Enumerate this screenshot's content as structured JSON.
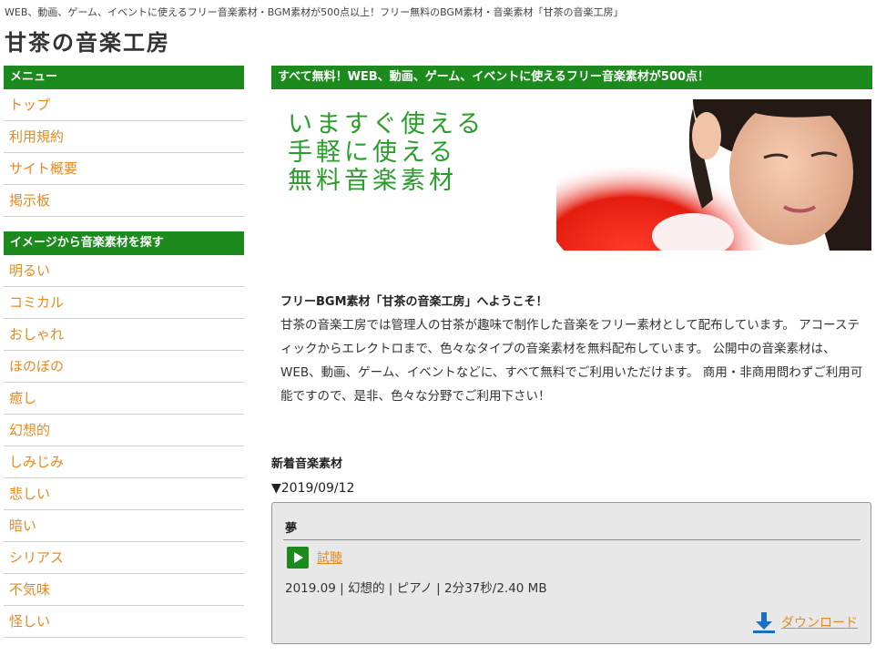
{
  "header": {
    "tagline": "WEB、動画、ゲーム、イベントに使えるフリー音楽素材・BGM素材が500点以上！フリー無料のBGM素材・音楽素材「甘茶の音楽工房」",
    "site_title": "甘茶の音楽工房"
  },
  "sidebar": {
    "menu_heading": "メニュー",
    "menu_items": [
      "トップ",
      "利用規約",
      "サイト概要",
      "掲示板"
    ],
    "image_heading": "イメージから音楽素材を探す",
    "image_items": [
      "明るい",
      "コミカル",
      "おしゃれ",
      "ほのぼの",
      "癒し",
      "幻想的",
      "しみじみ",
      "悲しい",
      "暗い",
      "シリアス",
      "不気味",
      "怪しい"
    ]
  },
  "main": {
    "banner_heading": "すべて無料！WEB、動画、ゲーム、イベントに使えるフリー音楽素材が500点！",
    "hero_lines": [
      "いますぐ使える",
      "手軽に使える",
      "無料音楽素材"
    ],
    "welcome_title": "フリーBGM素材「甘茶の音楽工房」へようこそ！",
    "welcome_body": "甘茶の音楽工房では管理人の甘茶が趣味で制作した音楽をフリー素材として配布しています。 アコースティックからエレクトロまで、色々なタイプの音楽素材を無料配布しています。 公開中の音楽素材は、WEB、動画、ゲーム、イベントなどに、すべて無料でご利用いただけます。 商用・非商用問わずご利用可能ですので、是非、色々な分野でご利用下さい！",
    "news_heading": "新着音楽素材",
    "news_date": "▼2019/09/12"
  },
  "track": {
    "title": "夢",
    "listen_label": "試聴",
    "meta": "2019.09 | 幻想的 | ピアノ | 2分37秒/2.40 MB",
    "download_label": "ダウンロード"
  },
  "colors": {
    "accent_green": "#1d8a1d",
    "link_orange": "#e8891f",
    "hero_green": "#2a9d2a"
  },
  "icons": {
    "play": "play-icon",
    "download": "download-icon"
  }
}
